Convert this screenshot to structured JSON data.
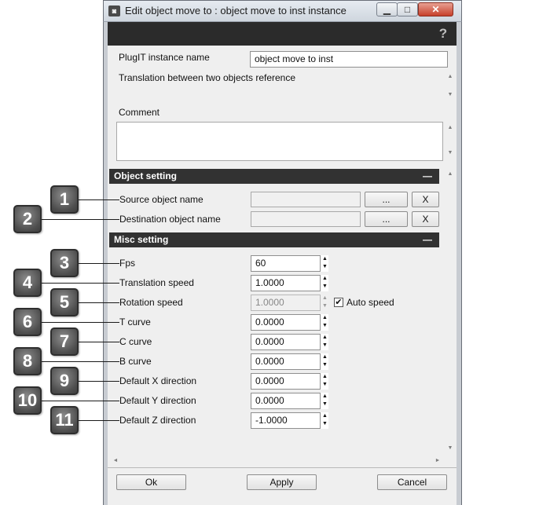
{
  "window": {
    "title": "Edit object move to : object move to inst instance",
    "minimize_glyph": "▁",
    "maximize_glyph": "□",
    "close_glyph": "✕",
    "help_glyph": "?"
  },
  "instance": {
    "name_label": "PlugIT instance name",
    "name_value": "object move to inst",
    "description": "Translation between two objects reference"
  },
  "comment": {
    "label": "Comment",
    "value": ""
  },
  "object_setting": {
    "title": "Object setting",
    "collapse_glyph": "—",
    "source_label": "Source object name",
    "destination_label": "Destination object name",
    "browse_label": "...",
    "clear_label": "X"
  },
  "misc_setting": {
    "title": "Misc setting",
    "collapse_glyph": "—",
    "fps_label": "Fps",
    "fps_value": "60",
    "translation_speed_label": "Translation speed",
    "translation_speed_value": "1.0000",
    "rotation_speed_label": "Rotation speed",
    "rotation_speed_value": "1.0000",
    "auto_speed_label": "Auto speed",
    "auto_speed_checked": true,
    "check_glyph": "✔",
    "t_curve_label": "T curve",
    "t_curve_value": "0.0000",
    "c_curve_label": "C curve",
    "c_curve_value": "0.0000",
    "b_curve_label": "B curve",
    "b_curve_value": "0.0000",
    "default_x_label": "Default X direction",
    "default_x_value": "0.0000",
    "default_y_label": "Default Y direction",
    "default_y_value": "0.0000",
    "default_z_label": "Default Z direction",
    "default_z_value": "-1.0000"
  },
  "callouts": [
    "1",
    "2",
    "3",
    "4",
    "5",
    "6",
    "7",
    "8",
    "9",
    "10",
    "11"
  ],
  "footer": {
    "ok_label": "Ok",
    "apply_label": "Apply",
    "cancel_label": "Cancel"
  },
  "glyphs": {
    "up": "▲",
    "down": "▼",
    "left": "◄",
    "right": "►"
  },
  "colors": {
    "section_bar": "#323232",
    "header_dark": "#2b2b2b",
    "badge": "#5a5a5a"
  }
}
